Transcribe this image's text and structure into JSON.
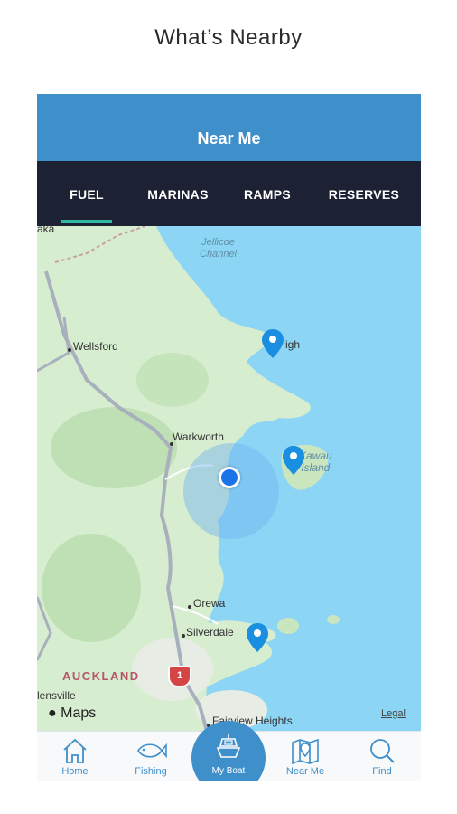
{
  "caption": "What’s Nearby",
  "header": {
    "title": "Near Me"
  },
  "tabs": [
    {
      "label": "FUEL",
      "active": true
    },
    {
      "label": "MARINAS",
      "active": false
    },
    {
      "label": "RAMPS",
      "active": false
    },
    {
      "label": "RESERVES",
      "active": false
    }
  ],
  "map": {
    "water_labels": {
      "channel": "Jellicoe\nChannel",
      "island": "Kawau\nIsland"
    },
    "towns": {
      "top_partial": "aka",
      "wellsford": "Wellsford",
      "warkworth": "Warkworth",
      "orewa": "Orewa",
      "silverdale": "Silverdale",
      "helensville": "lensville",
      "fairview": "Fairview Heights",
      "leigh": "igh"
    },
    "region": "AUCKLAND",
    "highway_number": "1",
    "attribution": "Maps",
    "legal": "Legal",
    "colors": {
      "water": "#8dd5f5",
      "land": "#d7edd0",
      "pin": "#1a8ee0",
      "user": "#1a73e8"
    },
    "pins": [
      "leigh-fuel-pin",
      "kawau-fuel-pin",
      "whangaparaoa-fuel-pin"
    ]
  },
  "bottom_nav": {
    "home": "Home",
    "fishing": "Fishing",
    "my_boat": "My Boat",
    "near_me": "Near Me",
    "find": "Find"
  }
}
